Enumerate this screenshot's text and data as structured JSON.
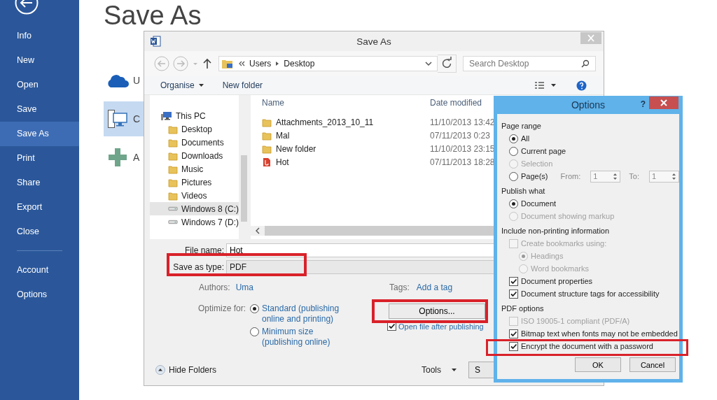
{
  "backstage": {
    "menu": [
      {
        "label": "Info",
        "selected": false
      },
      {
        "label": "New",
        "selected": false
      },
      {
        "label": "Open",
        "selected": false
      },
      {
        "label": "Save",
        "selected": false
      },
      {
        "label": "Save As",
        "selected": true
      },
      {
        "label": "Print",
        "selected": false
      },
      {
        "label": "Share",
        "selected": false
      },
      {
        "label": "Export",
        "selected": false
      },
      {
        "label": "Close",
        "selected": false
      }
    ],
    "menu_bottom": [
      {
        "label": "Account",
        "selected": false
      },
      {
        "label": "Options",
        "selected": false
      }
    ],
    "heading": "Save As",
    "places": [
      {
        "kind": "cloud",
        "label": "U",
        "selected": false
      },
      {
        "kind": "computer",
        "label": "C",
        "selected": true
      },
      {
        "kind": "add",
        "label": "A",
        "selected": false
      }
    ]
  },
  "save_dialog": {
    "title": "Save As",
    "address": [
      "Users",
      "Desktop"
    ],
    "search": {
      "placeholder": "Search Desktop"
    },
    "toolbar": {
      "organise": "Organise",
      "new_folder": "New folder"
    },
    "nav": [
      {
        "label": "This PC",
        "kind": "computer",
        "selected": false,
        "children": [
          {
            "label": "Desktop",
            "kind": "folder",
            "selected": false
          },
          {
            "label": "Documents",
            "kind": "folder",
            "selected": false
          },
          {
            "label": "Downloads",
            "kind": "folder",
            "selected": false
          },
          {
            "label": "Music",
            "kind": "folder",
            "selected": false
          },
          {
            "label": "Pictures",
            "kind": "folder",
            "selected": false
          },
          {
            "label": "Videos",
            "kind": "folder",
            "selected": false
          },
          {
            "label": "Windows 8 (C:)",
            "kind": "drive",
            "selected": true
          },
          {
            "label": "Windows 7 (D:)",
            "kind": "drive",
            "selected": false
          }
        ]
      }
    ],
    "columns": [
      "Name",
      "Date modified"
    ],
    "files": [
      {
        "name": "Attachments_2013_10_11",
        "date": "11/10/2013 13:42",
        "kind": "folder"
      },
      {
        "name": "Mal",
        "date": "07/11/2013 0:23",
        "kind": "folder"
      },
      {
        "name": "New folder",
        "date": "11/10/2013 23:15",
        "kind": "folder"
      },
      {
        "name": "Hot",
        "date": "07/11/2013 18:28",
        "kind": "pdf"
      }
    ],
    "file_name_label": "File name:",
    "file_name": "Hot",
    "type_label": "Save as type:",
    "type": "PDF",
    "authors_label": "Authors:",
    "authors": "Uma",
    "tags_label": "Tags:",
    "tags": "Add a tag",
    "optimize_label": "Optimize for:",
    "optimize": [
      {
        "label": "Standard (publishing online and printing)",
        "selected": true
      },
      {
        "label": "Minimum size (publishing online)",
        "selected": false
      }
    ],
    "options_button": "Options...",
    "open_after": {
      "label": "Open file after publishing",
      "checked": true
    },
    "hide_folders": "Hide Folders",
    "tools": "Tools",
    "save_button": "S"
  },
  "options_dialog": {
    "title": "Options",
    "help": "?",
    "sections": [
      {
        "title": "Page range",
        "items": [
          {
            "kind": "radio",
            "label": "All",
            "selected": true,
            "disabled": false
          },
          {
            "kind": "radio",
            "label": "Current page",
            "selected": false,
            "disabled": false
          },
          {
            "kind": "radio",
            "label": "Selection",
            "selected": false,
            "disabled": true
          },
          {
            "kind": "range",
            "label": "Page(s)",
            "selected": false,
            "disabled": false,
            "from_label": "From:",
            "from": "1",
            "to_label": "To:",
            "to": "1"
          }
        ]
      },
      {
        "title": "Publish what",
        "items": [
          {
            "kind": "radio",
            "label": "Document",
            "selected": true,
            "disabled": false
          },
          {
            "kind": "radio",
            "label": "Document showing markup",
            "selected": false,
            "disabled": true
          }
        ]
      },
      {
        "title": "Include non-printing information",
        "items": [
          {
            "kind": "checkbox",
            "label": "Create bookmarks using:",
            "checked": false,
            "disabled": true,
            "children": [
              {
                "kind": "radio",
                "label": "Headings",
                "selected": true,
                "disabled": true
              },
              {
                "kind": "radio",
                "label": "Word bookmarks",
                "selected": false,
                "disabled": true
              }
            ]
          },
          {
            "kind": "checkbox",
            "label": "Document properties",
            "checked": true,
            "disabled": false
          },
          {
            "kind": "checkbox",
            "label": "Document structure tags for accessibility",
            "checked": true,
            "disabled": false
          }
        ]
      },
      {
        "title": "PDF options",
        "items": [
          {
            "kind": "checkbox",
            "label": "ISO 19005-1 compliant (PDF/A)",
            "checked": false,
            "disabled": true
          },
          {
            "kind": "checkbox",
            "label": "Bitmap text when fonts may not be embedded",
            "checked": true,
            "disabled": false
          },
          {
            "kind": "checkbox",
            "label": "Encrypt the document with a password",
            "checked": true,
            "disabled": false
          }
        ]
      }
    ],
    "buttons": [
      "OK",
      "Cancel"
    ]
  }
}
